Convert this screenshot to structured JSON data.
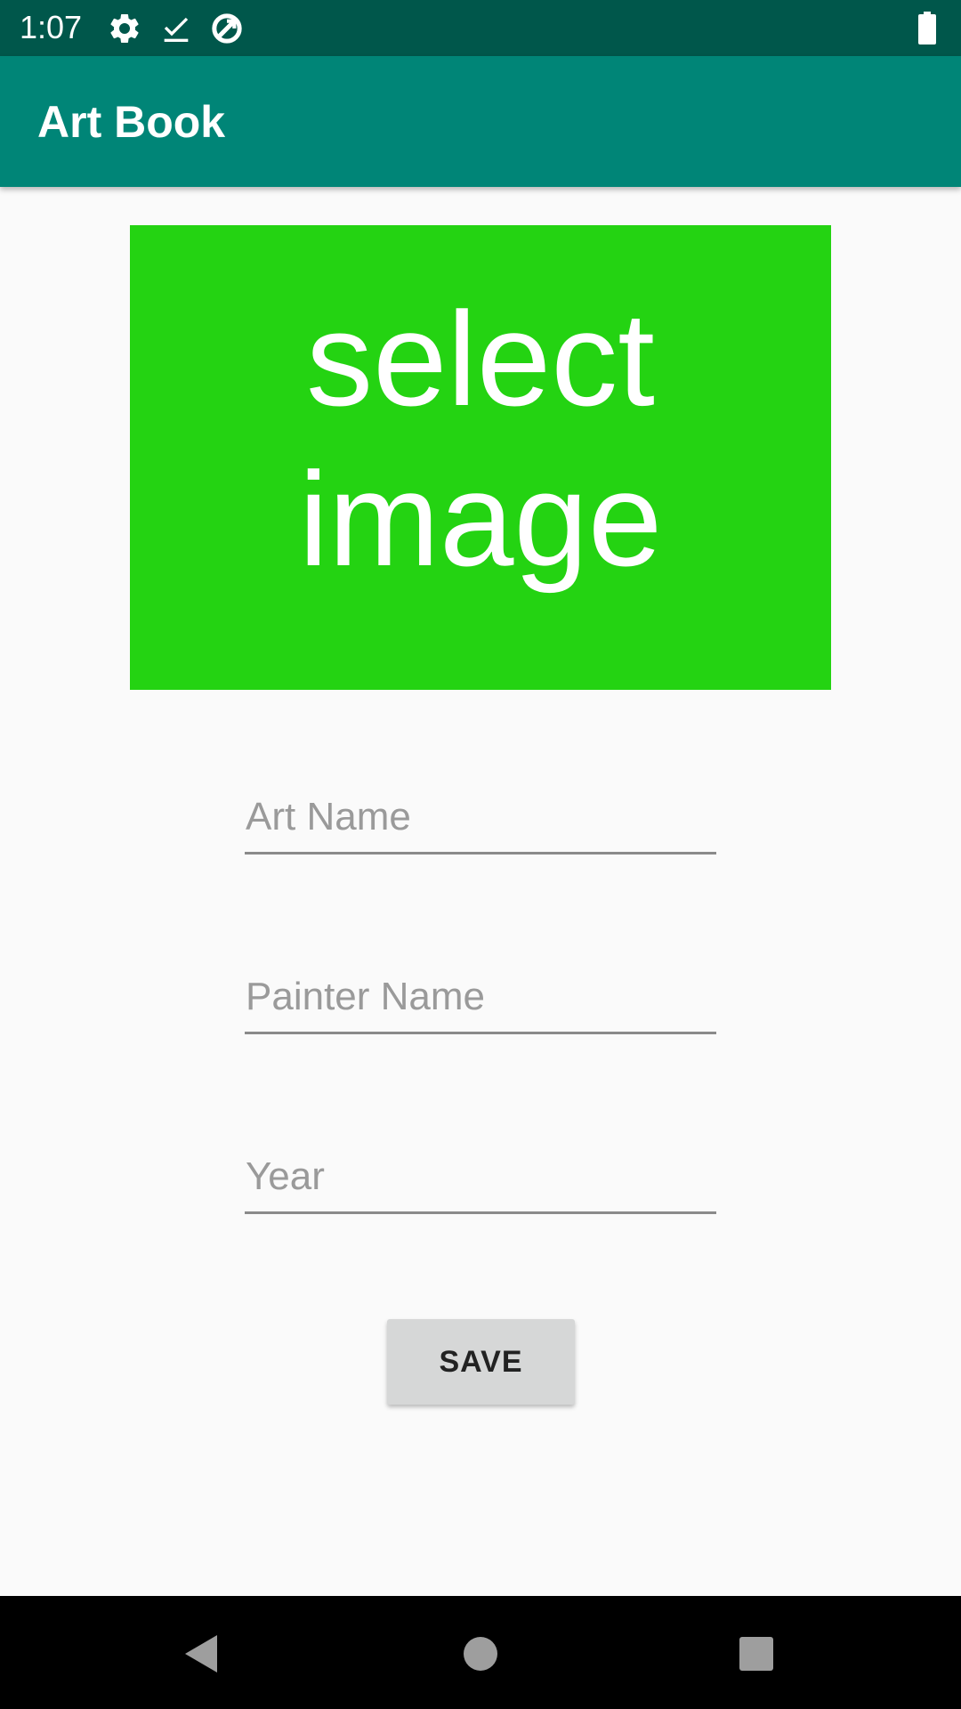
{
  "status_bar": {
    "time": "1:07",
    "icons": [
      "gear-icon",
      "download-check-icon",
      "data-saver-icon",
      "battery-icon"
    ]
  },
  "app_bar": {
    "title": "Art Book"
  },
  "image_selector": {
    "line1": "select",
    "line2": "image",
    "color": "#24d312"
  },
  "form": {
    "art_name_placeholder": "Art Name",
    "painter_name_placeholder": "Painter Name",
    "year_placeholder": "Year",
    "art_name_value": "",
    "painter_name_value": "",
    "year_value": ""
  },
  "actions": {
    "save_label": "SAVE"
  },
  "nav_bar": {
    "buttons": [
      "back-icon",
      "home-icon",
      "recents-icon"
    ]
  },
  "colors": {
    "status_bar": "#00574b",
    "app_bar": "#008577",
    "background": "#fafafa",
    "button": "#d6d7d7"
  }
}
